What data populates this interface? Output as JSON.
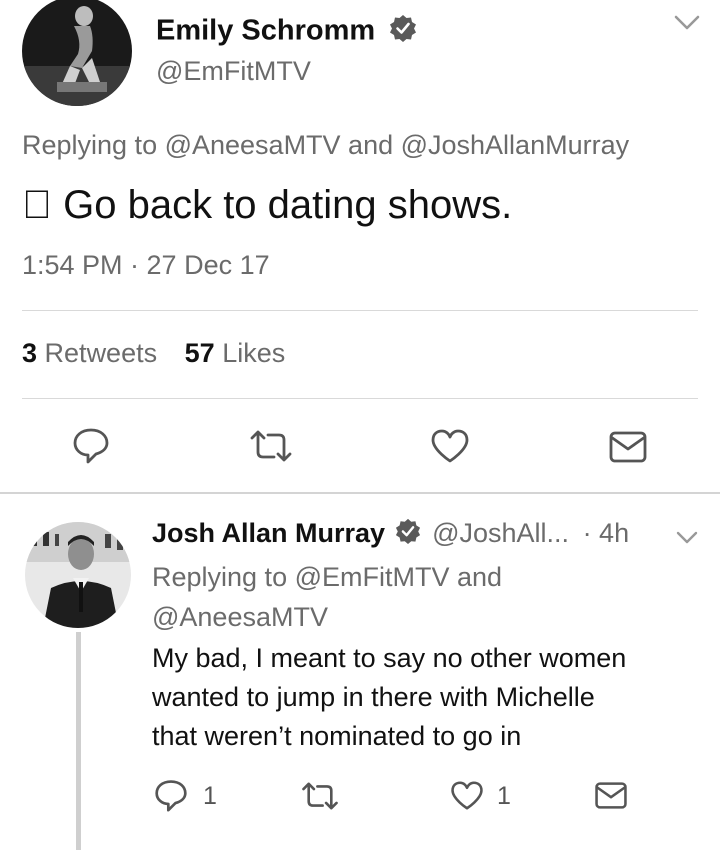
{
  "tweet": {
    "author_name": "Emily Schromm",
    "author_handle": "@EmFitMTV",
    "verified": true,
    "replying_to": "Replying to @AneesaMTV and @JoshAllanMurray",
    "text": "\u0000 Go back to dating shows.",
    "timestamp": "1:54 PM · 27 Dec 17",
    "stats": {
      "retweets_count": "3",
      "retweets_label": "Retweets",
      "likes_count": "57",
      "likes_label": "Likes"
    },
    "actions": [
      "reply-icon",
      "retweet-icon",
      "like-icon",
      "message-icon"
    ]
  },
  "reply": {
    "author_name": "Josh Allan Murray",
    "author_handle": "@JoshAll...",
    "time": "· 4h",
    "verified": true,
    "replying_to_line1": "Replying to @EmFitMTV and",
    "replying_to_line2": "@AneesaMTV",
    "text_line1": "My bad, I meant to say no other women",
    "text_line2": "wanted to jump in there with Michelle",
    "text_line3": "that weren’t nominated to go in",
    "reply_count": "1",
    "like_count": "1",
    "actions": [
      "reply-icon",
      "retweet-icon",
      "like-icon",
      "message-icon"
    ]
  }
}
